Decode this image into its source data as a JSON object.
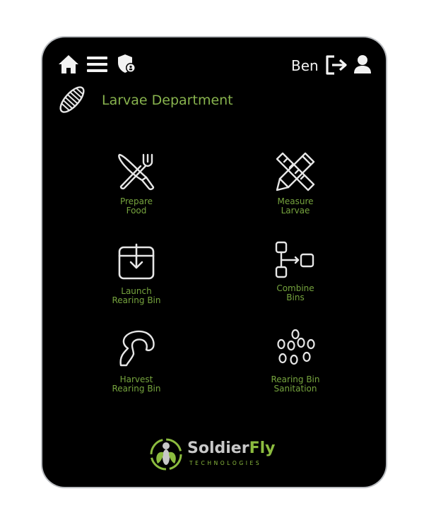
{
  "header": {
    "username": "Ben",
    "icons": [
      "home-icon",
      "menu-icon",
      "shield-user-icon",
      "logout-icon",
      "user-icon"
    ]
  },
  "department": {
    "title": "Larvae Department",
    "icon": "larva-icon"
  },
  "tiles": [
    {
      "id": "prepare-food",
      "label": "Prepare\nFood",
      "icon": "knife-fork-icon"
    },
    {
      "id": "measure-larvae",
      "label": "Measure\nLarvae",
      "icon": "ruler-pencil-icon"
    },
    {
      "id": "launch-rearing-bin",
      "label": "Launch\nRearing Bin",
      "icon": "download-box-icon"
    },
    {
      "id": "combine-bins",
      "label": "Combine\nBins",
      "icon": "flow-boxes-icon"
    },
    {
      "id": "harvest-rearing-bin",
      "label": "Harvest\nRearing Bin",
      "icon": "hook-icon"
    },
    {
      "id": "rearing-bin-sanitation",
      "label": "Rearing Bin\nSanitation",
      "icon": "droplets-icon"
    }
  ],
  "brand": {
    "name_part1": "Soldier",
    "name_part2": "Fly",
    "subtitle": "TECHNOLOGIES"
  },
  "colors": {
    "background": "#000000",
    "accent_green": "#76a43e",
    "icon_stroke": "#e6e6e6",
    "device_frame": "#b9bcc0"
  }
}
